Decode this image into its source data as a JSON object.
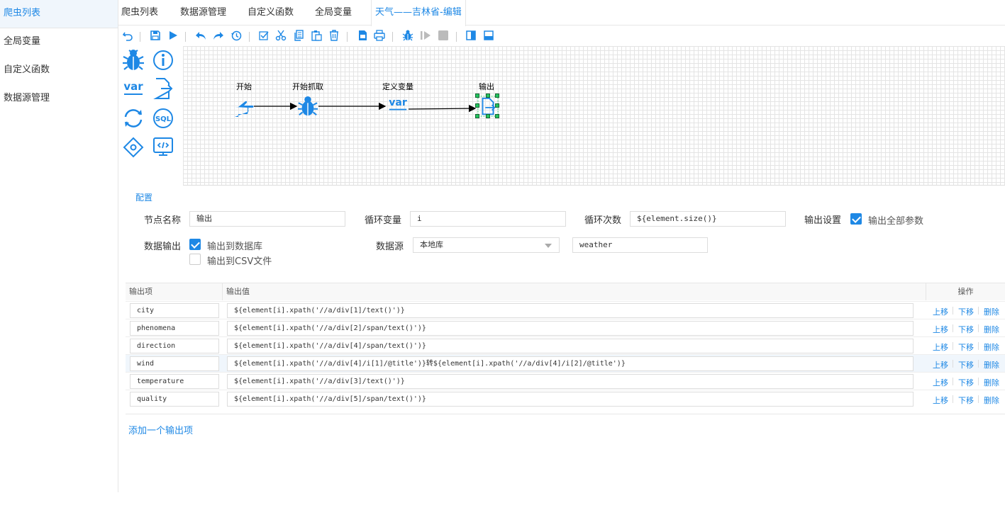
{
  "sidebar": {
    "items": [
      {
        "label": "爬虫列表",
        "active": true
      },
      {
        "label": "全局变量",
        "active": false
      },
      {
        "label": "自定义函数",
        "active": false
      },
      {
        "label": "数据源管理",
        "active": false
      }
    ]
  },
  "tabs": [
    {
      "label": "爬虫列表"
    },
    {
      "label": "数据源管理"
    },
    {
      "label": "自定义函数"
    },
    {
      "label": "全局变量"
    },
    {
      "label": "天气——吉林省-编辑",
      "active": true
    }
  ],
  "toolbar": {
    "icons": [
      "undo-icon",
      "save-icon",
      "run-icon",
      "undo-arrow-icon",
      "redo-arrow-icon",
      "history-icon",
      "select-all-icon",
      "cut-icon",
      "copy-icon",
      "paste-icon",
      "delete-icon",
      "export-icon",
      "print-icon",
      "debug-icon",
      "step-icon",
      "stop-icon",
      "sidebar-right-icon",
      "panel-bottom-icon"
    ]
  },
  "colors": {
    "accent": "#1e88e5",
    "selection": "#22c55e"
  },
  "flow": {
    "nodes": [
      {
        "label": "开始",
        "icon": "hand-point-icon"
      },
      {
        "label": "开始抓取",
        "icon": "bug-icon"
      },
      {
        "label": "定义变量",
        "icon": "var-icon"
      },
      {
        "label": "输出",
        "icon": "file-output-icon"
      }
    ],
    "var_text": "var"
  },
  "palette": {
    "var_text": "var",
    "sql_text": "SQL"
  },
  "config": {
    "link": "配置",
    "node_name_label": "节点名称",
    "node_name_value": "输出",
    "loop_var_label": "循环变量",
    "loop_var_value": "i",
    "loop_count_label": "循环次数",
    "loop_count_value": "${element.size()}",
    "output_settings_label": "输出设置",
    "output_all_label": "输出全部参数",
    "data_output_label": "数据输出",
    "to_db_label": "输出到数据库",
    "to_csv_label": "输出到CSV文件",
    "datasource_label": "数据源",
    "datasource_value": "本地库",
    "table_value": "weather"
  },
  "table": {
    "headers": {
      "name": "输出项",
      "value": "输出值",
      "ops": "操作"
    },
    "ops": {
      "up": "上移",
      "down": "下移",
      "delete": "删除"
    },
    "rows": [
      {
        "name": "city",
        "value": "${element[i].xpath('//a/div[1]/text()')}"
      },
      {
        "name": "phenomena",
        "value": "${element[i].xpath('//a/div[2]/span/text()')}"
      },
      {
        "name": "direction",
        "value": "${element[i].xpath('//a/div[4]/span/text()')}"
      },
      {
        "name": "wind",
        "value": "${element[i].xpath('//a/div[4]/i[1]/@title')}转${element[i].xpath('//a/div[4]/i[2]/@title')}"
      },
      {
        "name": "temperature",
        "value": "${element[i].xpath('//a/div[3]/text()')}"
      },
      {
        "name": "quality",
        "value": "${element[i].xpath('//a/div[5]/span/text()')}"
      }
    ]
  },
  "add_output": "添加一个输出项"
}
